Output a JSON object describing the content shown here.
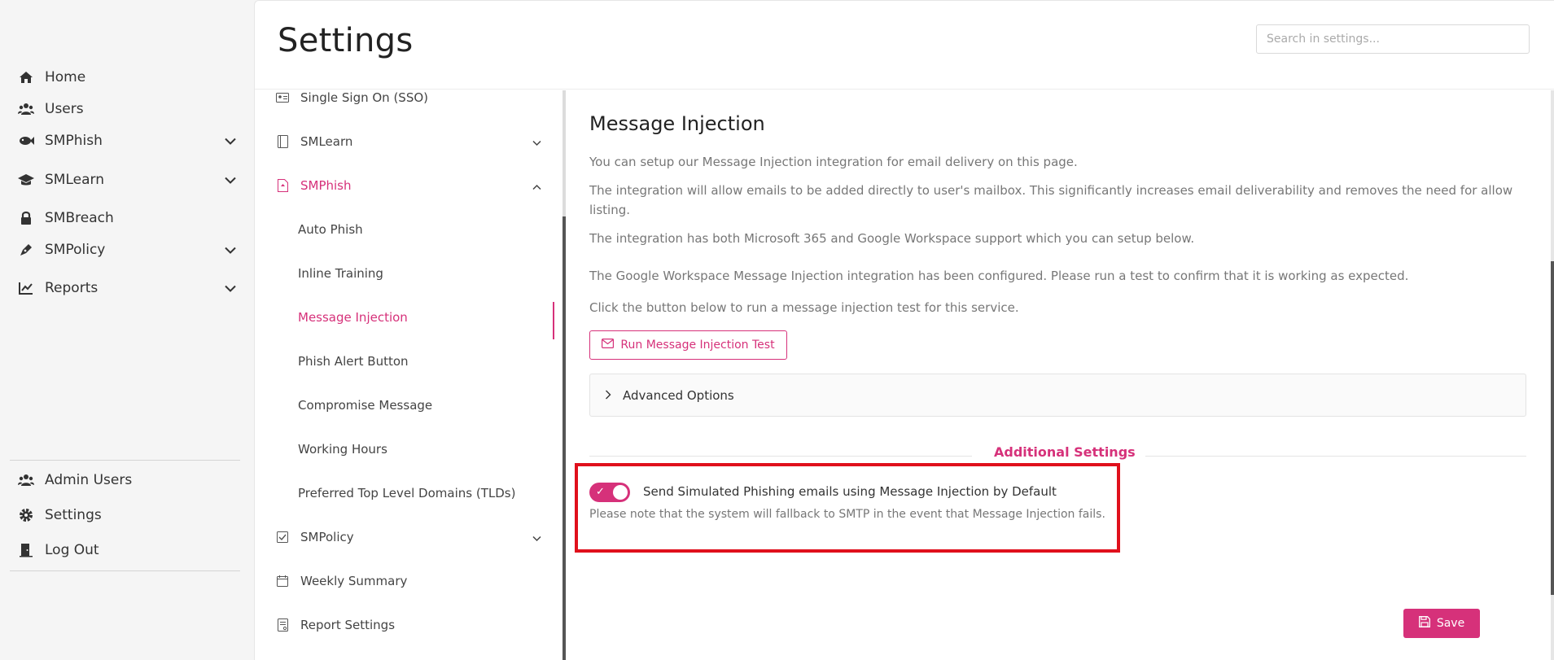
{
  "nav": {
    "items": [
      {
        "label": "Home",
        "icon": "home-icon"
      },
      {
        "label": "Users",
        "icon": "users-icon"
      },
      {
        "label": "SMPhish",
        "icon": "fish-icon"
      },
      {
        "label": "SMLearn",
        "icon": "graduation-cap-icon"
      },
      {
        "label": "SMBreach",
        "icon": "lock-icon"
      },
      {
        "label": "SMPolicy",
        "icon": "pen-icon"
      },
      {
        "label": "Reports",
        "icon": "chart-icon"
      }
    ],
    "bottom": [
      {
        "label": "Admin Users",
        "icon": "users-icon"
      },
      {
        "label": "Settings",
        "icon": "gear-icon"
      },
      {
        "label": "Log Out",
        "icon": "door-icon"
      }
    ]
  },
  "header": {
    "title": "Settings",
    "search_placeholder": "Search in settings..."
  },
  "subnav": {
    "sso": "Single Sign On (SSO)",
    "smlearn": "SMLearn",
    "smphish": "SMPhish",
    "children": [
      "Auto Phish",
      "Inline Training",
      "Message Injection",
      "Phish Alert Button",
      "Compromise Message",
      "Working Hours",
      "Preferred Top Level Domains (TLDs)"
    ],
    "smpolicy": "SMPolicy",
    "weekly": "Weekly Summary",
    "report": "Report Settings"
  },
  "content": {
    "title": "Message Injection",
    "p1": "You can setup our Message Injection integration for email delivery on this page.",
    "p2": "The integration will allow emails to be added directly to user's mailbox. This significantly increases email deliverability and removes the need for allow listing.",
    "p3": "The integration has both Microsoft 365 and Google Workspace support which you can setup below.",
    "p4": "The Google Workspace Message Injection integration has been configured. Please run a test to confirm that it is working as expected.",
    "p5": "Click the button below to run a message injection test for this service.",
    "run_button": "Run Message Injection Test",
    "advanced": "Advanced Options",
    "additional_title": "Additional Settings",
    "toggle_label": "Send Simulated Phishing emails using Message Injection by Default",
    "toggle_note": "Please note that the system will fallback to SMTP in the event that Message Injection fails.",
    "toggle_on": true,
    "save": "Save"
  },
  "colors": {
    "accent": "#d6317a",
    "highlight": "#e0101c"
  }
}
